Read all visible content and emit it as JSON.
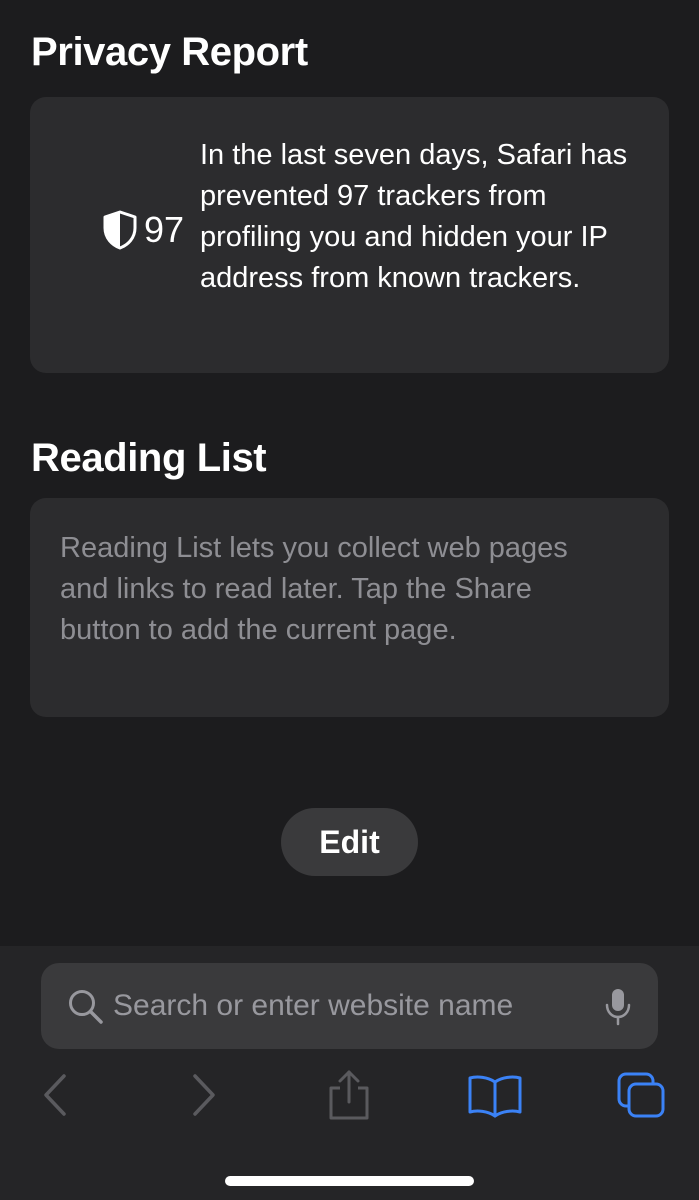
{
  "privacy_report": {
    "title": "Privacy Report",
    "tracker_count": "97",
    "description": "In the last seven days, Safari has prevented 97 trackers from profiling you and hidden your IP address from known trackers.",
    "icon": "shield-icon"
  },
  "reading_list": {
    "title": "Reading List",
    "description": "Reading List lets you collect web pages and links to read later. Tap the Share button to add the current page."
  },
  "edit_button": {
    "label": "Edit"
  },
  "search": {
    "placeholder": "Search or enter website name",
    "value": ""
  },
  "toolbar": {
    "items": [
      {
        "name": "back",
        "icon": "chevron-left-icon",
        "enabled": false
      },
      {
        "name": "forward",
        "icon": "chevron-right-icon",
        "enabled": false
      },
      {
        "name": "share",
        "icon": "share-icon",
        "enabled": false
      },
      {
        "name": "bookmarks",
        "icon": "book-icon",
        "enabled": true
      },
      {
        "name": "tabs",
        "icon": "tabs-icon",
        "enabled": true
      }
    ]
  },
  "colors": {
    "background": "#1c1c1e",
    "card": "#2c2c2e",
    "accent": "#3b82f6",
    "disabled": "#5a5a5e",
    "secondary_text": "#8e8e93"
  }
}
